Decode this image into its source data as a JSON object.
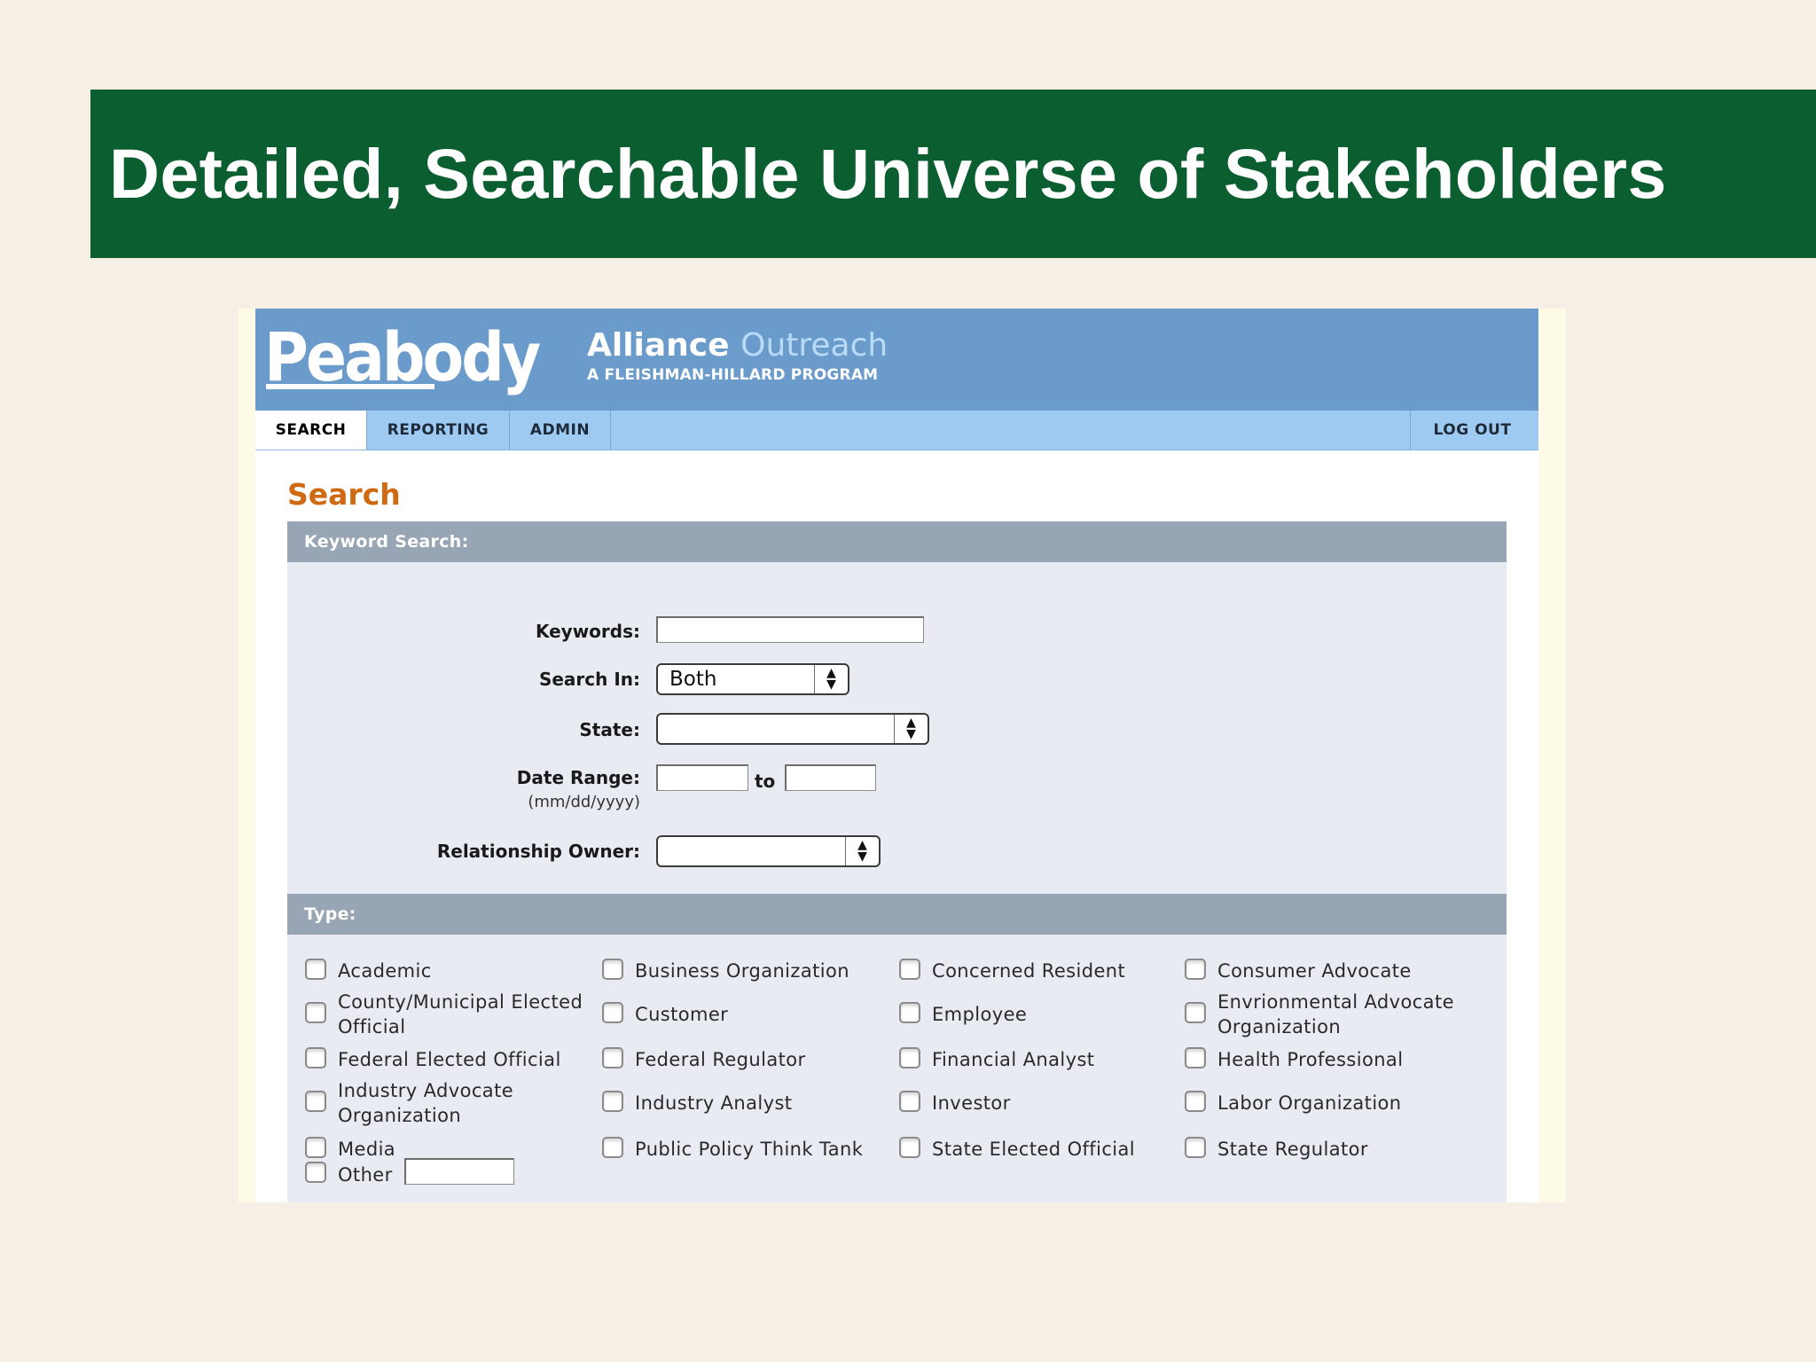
{
  "slide": {
    "title": "Detailed, Searchable Universe of Stakeholders"
  },
  "app": {
    "logo_text": "Peabody",
    "brand": {
      "name_part1": "Alliance",
      "name_part2": "Outreach",
      "subtitle": "A FLEISHMAN-HILLARD PROGRAM"
    },
    "nav": {
      "tabs": [
        "SEARCH",
        "REPORTING",
        "ADMIN"
      ],
      "active_tab": "SEARCH",
      "logout": "LOG OUT"
    },
    "page_heading": "Search",
    "keyword_section": {
      "header": "Keyword Search:",
      "keywords_label": "Keywords:",
      "keywords_value": "",
      "search_in_label": "Search In:",
      "search_in_value": "Both",
      "state_label": "State:",
      "state_value": "",
      "date_range_label": "Date Range:",
      "date_hint": "(mm/dd/yyyy)",
      "date_to": "to",
      "date_from_value": "",
      "date_to_value": "",
      "owner_label": "Relationship Owner:",
      "owner_value": ""
    },
    "type_section": {
      "header": "Type:",
      "options": [
        [
          "Academic",
          "Business Organization",
          "Concerned Resident",
          "Consumer Advocate"
        ],
        [
          [
            "County/Municipal Elected",
            "Official"
          ],
          "Customer",
          "Employee",
          [
            "Envrionmental Advocate",
            "Organization"
          ]
        ],
        [
          "Federal Elected Official",
          "Federal Regulator",
          "Financial Analyst",
          "Health Professional"
        ],
        [
          [
            "Industry Advocate",
            "Organization"
          ],
          "Industry Analyst",
          "Investor",
          "Labor Organization"
        ],
        [
          "Media",
          "Public Policy Think Tank",
          "State Elected Official",
          "State Regulator"
        ]
      ],
      "other_label": "Other",
      "other_value": ""
    },
    "colors": {
      "title_bar": "#0b5e30",
      "header": "#6a9bcb",
      "nav": "#9ecaf1",
      "heading": "#d06a12",
      "section_header": "#98a5b4"
    }
  }
}
